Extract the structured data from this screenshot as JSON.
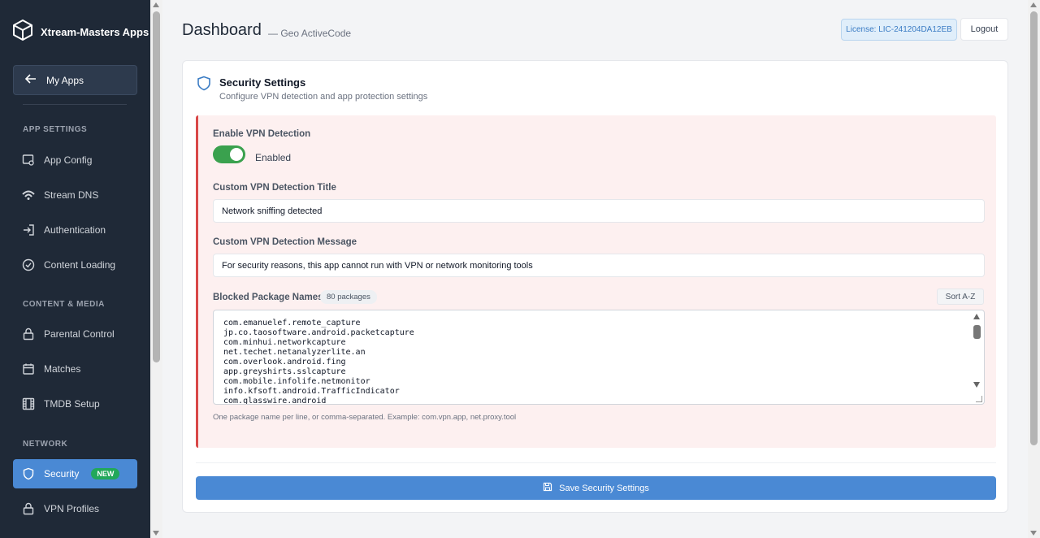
{
  "brand": {
    "name": "Xtream-Masters Apps"
  },
  "sidebar": {
    "back": {
      "label": "My Apps"
    },
    "sections": [
      {
        "title": "APP SETTINGS",
        "items": [
          {
            "label": "App Config",
            "icon": "app-config-icon"
          },
          {
            "label": "Stream DNS",
            "icon": "wifi-icon"
          },
          {
            "label": "Authentication",
            "icon": "login-icon"
          },
          {
            "label": "Content Loading",
            "icon": "check-circle-icon"
          }
        ]
      },
      {
        "title": "CONTENT & MEDIA",
        "items": [
          {
            "label": "Parental Control",
            "icon": "lock-icon"
          },
          {
            "label": "Matches",
            "icon": "calendar-icon"
          },
          {
            "label": "TMDB Setup",
            "icon": "film-icon"
          }
        ]
      },
      {
        "title": "NETWORK",
        "items": [
          {
            "label": "Security",
            "icon": "shield-icon",
            "badge": "NEW",
            "active": true
          },
          {
            "label": "VPN Profiles",
            "icon": "lock-icon"
          }
        ]
      }
    ]
  },
  "header": {
    "title": "Dashboard",
    "subtitle": "— Geo ActiveCode",
    "license": "License: LIC-241204DA12EB",
    "logout": "Logout"
  },
  "card": {
    "title": "Security Settings",
    "subtitle": "Configure VPN detection and app protection settings",
    "vpn_detection": {
      "label": "Enable VPN Detection",
      "state": "Enabled",
      "enabled": true
    },
    "custom_title": {
      "label": "Custom VPN Detection Title",
      "value": "Network sniffing detected"
    },
    "custom_message": {
      "label": "Custom VPN Detection Message",
      "value": "For security reasons, this app cannot run with VPN or network monitoring tools"
    },
    "blocked": {
      "label": "Blocked Package Names",
      "count": "80 packages",
      "sort": "Sort A-Z",
      "packages": [
        "com.emanuelef.remote_capture",
        "jp.co.taosoftware.android.packetcapture",
        "com.minhui.networkcapture",
        "net.techet.netanalyzerlite.an",
        "com.overlook.android.fing",
        "app.greyshirts.sslcapture",
        "com.mobile.infolife.netmonitor",
        "info.kfsoft.android.TrafficIndicator",
        "com.glasswire.android"
      ],
      "helper": "One package name per line, or comma-separated. Example: com.vpn.app, net.proxy.tool"
    },
    "save": "Save Security Settings"
  },
  "colors": {
    "sidebar_bg": "#1f2937",
    "accent": "#4a89d4",
    "toggle_on": "#3aa14e",
    "danger_border": "#d94848",
    "new_badge": "#22a85a"
  }
}
